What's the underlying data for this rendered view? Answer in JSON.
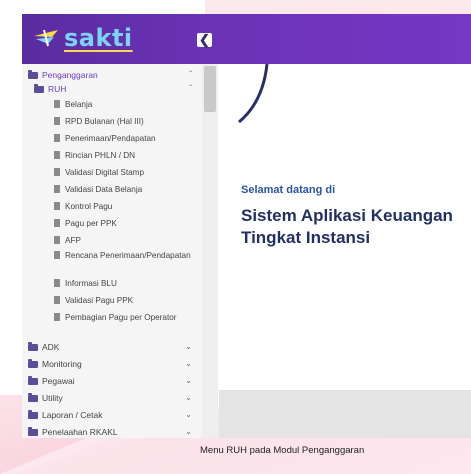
{
  "app": {
    "logo_text": "sakti",
    "collapse_icon": "chevron-left-icon"
  },
  "sidebar": {
    "section": {
      "label": "Penganggaran",
      "expanded": true
    },
    "group": {
      "label": "RUH",
      "expanded": true
    },
    "items": [
      {
        "label": "Belanja"
      },
      {
        "label": "RPD Bulanan (Hal III)"
      },
      {
        "label": "Penerimaan/Pendapatan"
      },
      {
        "label": "Rincian PHLN / DN"
      },
      {
        "label": "Validasi Digital Stamp"
      },
      {
        "label": "Validasi Data Belanja"
      },
      {
        "label": "Kontrol Pagu"
      },
      {
        "label": "Pagu per PPK"
      },
      {
        "label": "AFP"
      },
      {
        "label": "Rencana Penerimaan/Pendapatan"
      },
      {
        "label": "Informasi BLU"
      },
      {
        "label": "Validasi Pagu PPK"
      },
      {
        "label": "Pembagian Pagu per Operator"
      }
    ],
    "modules": [
      {
        "label": "ADK"
      },
      {
        "label": "Monitoring"
      },
      {
        "label": "Pegawai"
      },
      {
        "label": "Utility"
      },
      {
        "label": "Laporan / Cetak"
      },
      {
        "label": "Penelaahan RKAKL"
      }
    ]
  },
  "main": {
    "welcome": "Selamat datang di",
    "title": "Sistem Aplikasi Keuangan Tingkat Instansi"
  },
  "caption": "Menu RUH pada Modul Penganggaran",
  "colors": {
    "topbar": "#6a32b5",
    "logo": "#7dd3f7",
    "accent": "#2a55a6"
  }
}
